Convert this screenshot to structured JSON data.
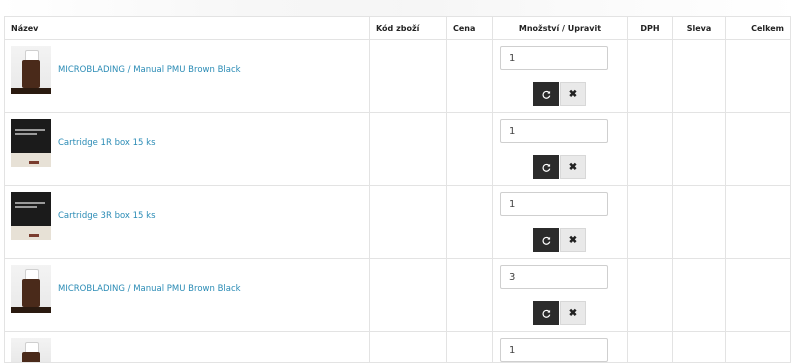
{
  "table": {
    "headers": {
      "name": "Název",
      "code": "Kód zboží",
      "price": "Cena",
      "qty": "Množství / Upravit",
      "vat": "DPH",
      "discount": "Sleva",
      "total": "Celkem"
    },
    "rows": [
      {
        "name": "MICROBLADING / Manual PMU Brown Black",
        "qty": "1",
        "thumb": "bottle"
      },
      {
        "name": "Cartridge 1R box 15 ks",
        "qty": "1",
        "thumb": "box"
      },
      {
        "name": "Cartridge 3R box 15 ks",
        "qty": "1",
        "thumb": "box"
      },
      {
        "name": "MICROBLADING / Manual PMU Brown Black",
        "qty": "3",
        "thumb": "bottle"
      },
      {
        "name": "",
        "qty": "1",
        "thumb": "bottle"
      }
    ]
  },
  "icons": {
    "refresh": "refresh-icon",
    "remove": "close-icon"
  },
  "colors": {
    "link": "#2a8bb5",
    "refresh_button": "#2b2b2b",
    "remove_button": "#e9e9e9"
  }
}
